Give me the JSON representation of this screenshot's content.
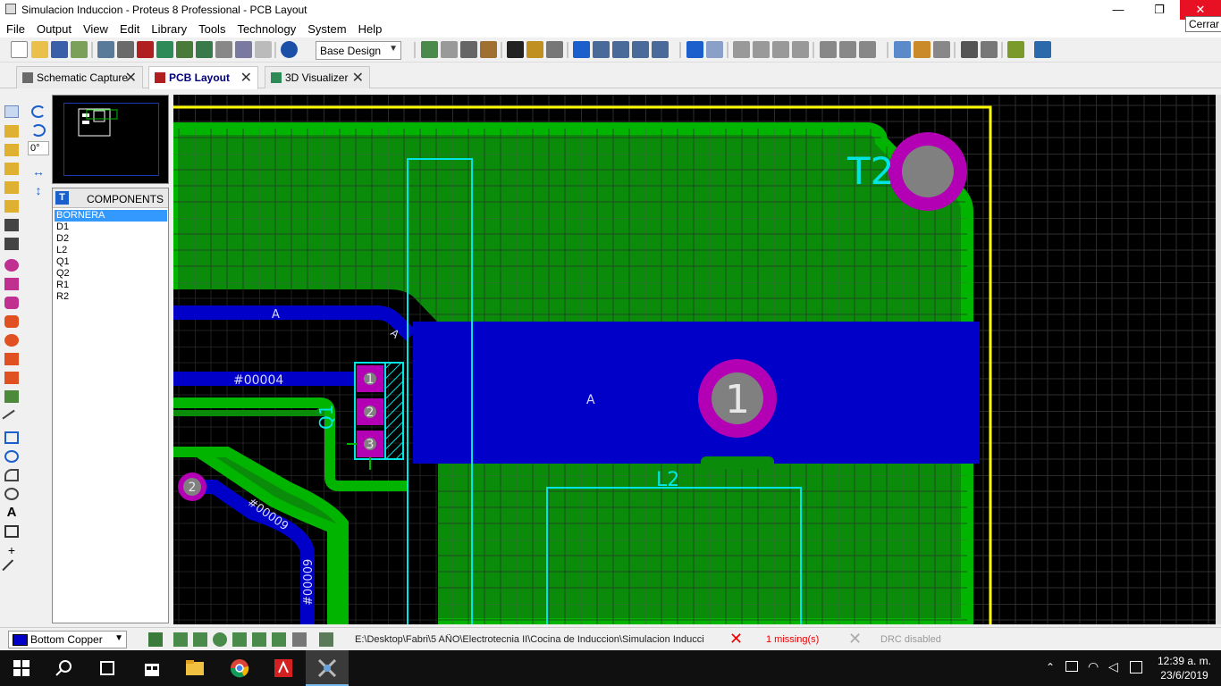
{
  "window": {
    "title": "Simulacion Induccion - Proteus 8 Professional - PCB Layout",
    "close_tooltip": "Cerrar",
    "min_glyph": "—",
    "max_glyph": "❐",
    "close_glyph": "✕"
  },
  "menu": {
    "items": [
      "File",
      "Output",
      "View",
      "Edit",
      "Library",
      "Tools",
      "Technology",
      "System",
      "Help"
    ]
  },
  "toolbar": {
    "design_select_value": "Base Design"
  },
  "tabs": [
    {
      "label": "Schematic Capture",
      "active": false
    },
    {
      "label": "PCB Layout",
      "active": true
    },
    {
      "label": "3D Visualizer",
      "active": false
    }
  ],
  "tab_close_glyph": "✕",
  "rotation": "0°",
  "components": {
    "header": "COMPONENTS",
    "header_button": "T",
    "items": [
      "BORNERA",
      "D1",
      "D2",
      "L2",
      "Q1",
      "Q2",
      "R1",
      "R2"
    ],
    "selected": "BORNERA"
  },
  "pcb": {
    "labels": {
      "t2": "T2",
      "l2": "L2",
      "q1": "Q1",
      "net_a_trace": "A",
      "net_a_diag": "A",
      "net_a_pad": "A",
      "net_00004": "#00004",
      "net_00009_diag": "#00009",
      "net_00009_vert": "#00009",
      "pad_1_big": "1",
      "pin_1": "1",
      "pin_2": "2",
      "pin_3": "3",
      "pad_2": "2"
    },
    "colors": {
      "background": "#000000",
      "grid": "#3a3a3a",
      "copper_pour": "#008c00",
      "copper_border": "#00b400",
      "bottom_copper": "#0000c8",
      "board_edge": "#ffff00",
      "silkscreen": "#00e6e6",
      "pad": "#b400b4",
      "pad_hole": "#808080"
    }
  },
  "status": {
    "layer": "Bottom Copper",
    "path": "E:\\Desktop\\Fabri\\5 AÑO\\Electrotecnia II\\Cocina de Induccion\\Simulacion Inducci",
    "missing": "1 missing(s)",
    "drc": "DRC disabled",
    "x_glyph": "✕"
  },
  "taskbar": {
    "time": "12:39 a. m.",
    "date": "23/6/2019"
  }
}
